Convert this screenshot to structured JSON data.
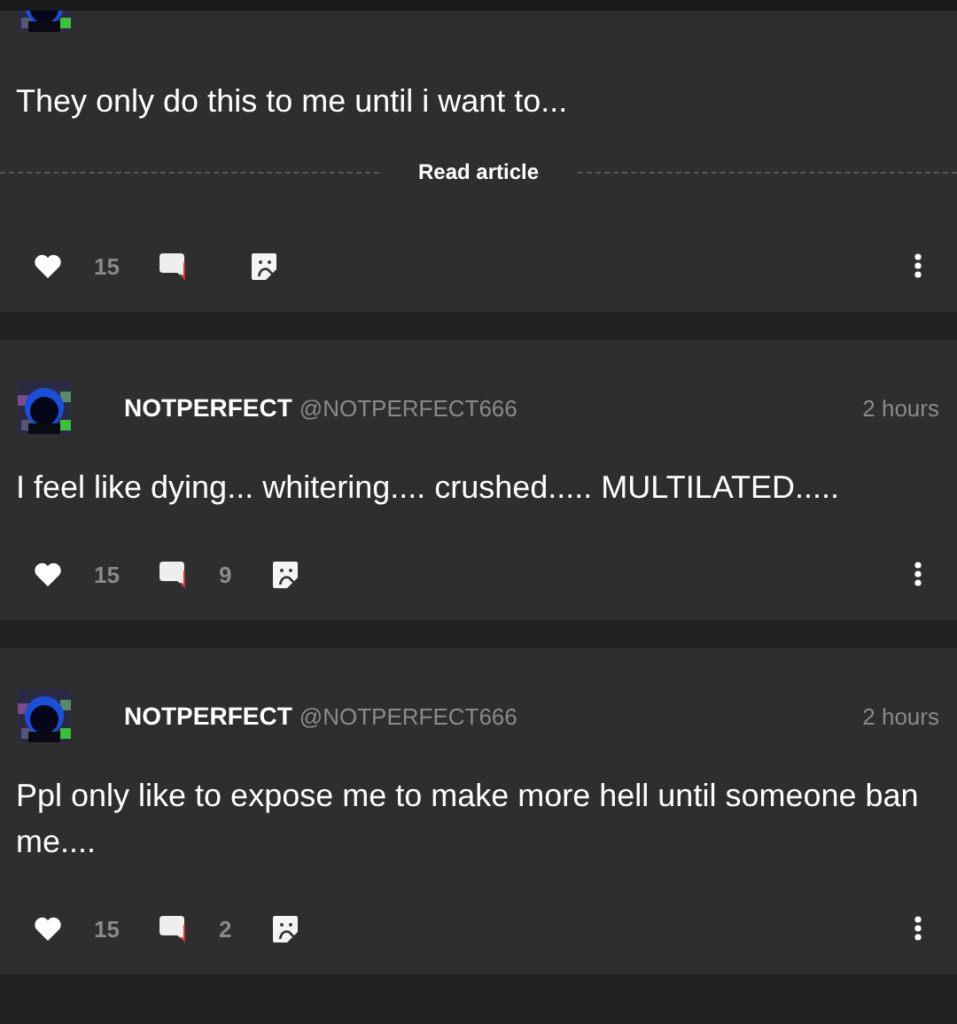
{
  "posts": [
    {
      "text": "They only do this to me until i want to...",
      "read_more": "Read article",
      "likes": "15"
    },
    {
      "author": "NOTPERFECT",
      "handle": "@NOTPERFECT666",
      "time": "2 hours",
      "text": "I feel like dying... whitering.... crushed..... MULTILATED.....",
      "likes": "15",
      "comments": "9"
    },
    {
      "author": "NOTPERFECT",
      "handle": "@NOTPERFECT666",
      "time": "2 hours",
      "text": "Ppl only like to expose me to make more hell until someone ban me....",
      "likes": "15",
      "comments": "2"
    }
  ]
}
